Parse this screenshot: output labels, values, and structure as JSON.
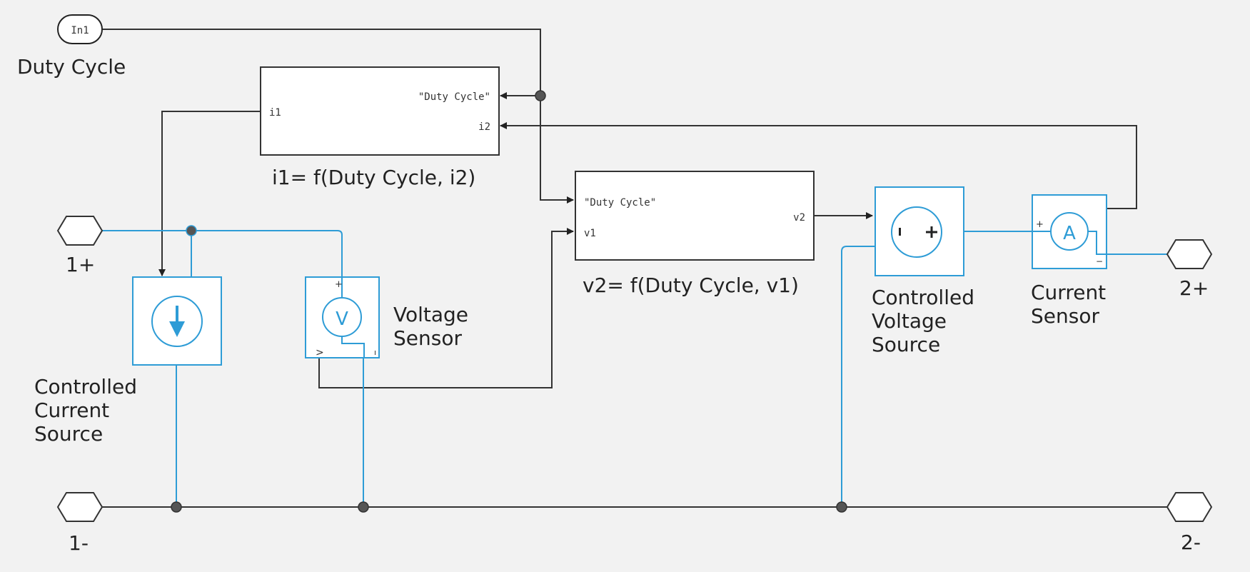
{
  "colors": {
    "background": "#f2f2f2",
    "physical_wire": "#2e9cd6",
    "signal_wire": "#333333",
    "block_fill": "#ffffff"
  },
  "inport": {
    "name": "In1",
    "label": "Duty Cycle"
  },
  "function_blocks": [
    {
      "id": "i1-block",
      "caption": "i1= f(Duty Cycle, i2)",
      "ports": {
        "left": [
          "i1"
        ],
        "right": [
          "\"Duty Cycle\"",
          "i2"
        ]
      }
    },
    {
      "id": "v2-block",
      "caption": "v2= f(Duty Cycle, v1)",
      "ports": {
        "left": [
          "\"Duty Cycle\"",
          "v1"
        ],
        "right": [
          "v2"
        ]
      }
    }
  ],
  "physical_blocks": [
    {
      "id": "controlled-current-source",
      "label": "Controlled\nCurrent\nSource",
      "icon": "down-arrow-icon"
    },
    {
      "id": "voltage-sensor",
      "label": "Voltage\nSensor",
      "icon_text": "V",
      "plus": "+",
      "minus": "ı",
      "out": ">"
    },
    {
      "id": "controlled-voltage-source",
      "label": "Controlled\nVoltage\nSource",
      "minus": "ı",
      "plus": "+"
    },
    {
      "id": "current-sensor",
      "label": "Current\nSensor",
      "icon_text": "A",
      "plus": "+",
      "minus": "−"
    }
  ],
  "connection_ports": [
    {
      "id": "port-1plus",
      "label": "1+"
    },
    {
      "id": "port-1minus",
      "label": "1-"
    },
    {
      "id": "port-2plus",
      "label": "2+"
    },
    {
      "id": "port-2minus",
      "label": "2-"
    }
  ]
}
